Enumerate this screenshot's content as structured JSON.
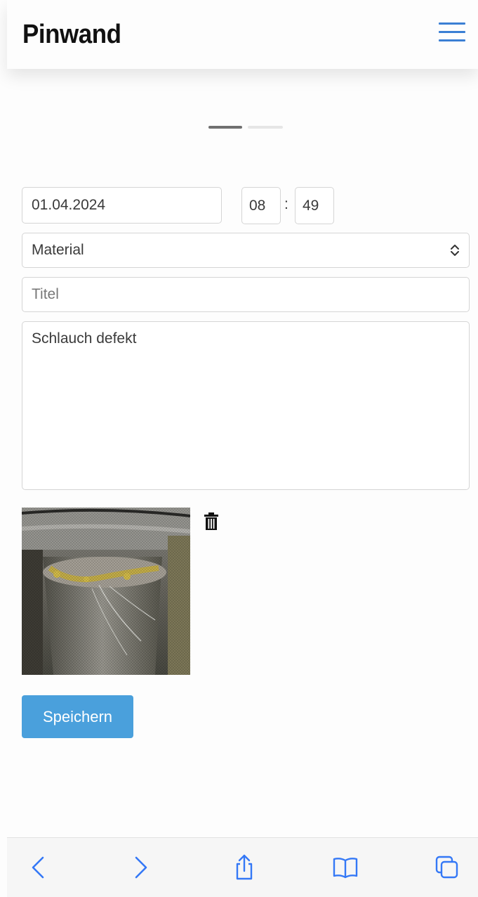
{
  "header": {
    "title": "Pinwand",
    "menu_icon": "hamburger-menu-icon"
  },
  "carousel": {
    "pages": 2,
    "active_page": 1
  },
  "form": {
    "date_value": "01.04.2024",
    "hour_value": "08",
    "time_separator": ":",
    "minute_value": "49",
    "category_selected": "Material",
    "title_placeholder": "Titel",
    "title_value": "",
    "description_value": "Schlauch defekt"
  },
  "attachment": {
    "image_icon": "photo-thumbnail",
    "delete_icon": "trash-icon"
  },
  "actions": {
    "save_label": "Speichern"
  },
  "browser_toolbar": {
    "icons": [
      "back-arrow-icon",
      "forward-arrow-icon",
      "share-icon",
      "bookmarks-icon",
      "tabs-icon"
    ]
  },
  "colors": {
    "accent": "#3b7fd4",
    "button": "#4aa0dc",
    "toolbar_icon": "#3478f6"
  }
}
